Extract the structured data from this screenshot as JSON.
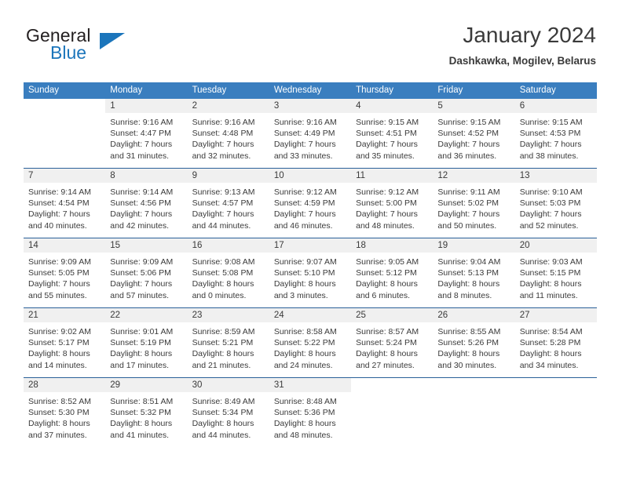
{
  "brand": {
    "name_line1": "General",
    "name_line2": "Blue",
    "logo_icon": "blue-triangle-icon",
    "accent_color": "#1b75bb"
  },
  "header": {
    "title": "January 2024",
    "subtitle": "Dashkawka, Mogilev, Belarus"
  },
  "theme": {
    "header_bar_color": "#3a7ebf",
    "week_divider_color": "#2a6099",
    "date_band_color": "#f0f0f0",
    "text_color": "#3a3a3a"
  },
  "weekdays": [
    "Sunday",
    "Monday",
    "Tuesday",
    "Wednesday",
    "Thursday",
    "Friday",
    "Saturday"
  ],
  "weeks": [
    {
      "dates": [
        "",
        "1",
        "2",
        "3",
        "4",
        "5",
        "6"
      ],
      "cells": [
        {
          "lines": [
            "",
            "",
            "",
            ""
          ]
        },
        {
          "lines": [
            "Sunrise: 9:16 AM",
            "Sunset: 4:47 PM",
            "Daylight: 7 hours",
            "and 31 minutes."
          ]
        },
        {
          "lines": [
            "Sunrise: 9:16 AM",
            "Sunset: 4:48 PM",
            "Daylight: 7 hours",
            "and 32 minutes."
          ]
        },
        {
          "lines": [
            "Sunrise: 9:16 AM",
            "Sunset: 4:49 PM",
            "Daylight: 7 hours",
            "and 33 minutes."
          ]
        },
        {
          "lines": [
            "Sunrise: 9:15 AM",
            "Sunset: 4:51 PM",
            "Daylight: 7 hours",
            "and 35 minutes."
          ]
        },
        {
          "lines": [
            "Sunrise: 9:15 AM",
            "Sunset: 4:52 PM",
            "Daylight: 7 hours",
            "and 36 minutes."
          ]
        },
        {
          "lines": [
            "Sunrise: 9:15 AM",
            "Sunset: 4:53 PM",
            "Daylight: 7 hours",
            "and 38 minutes."
          ]
        }
      ]
    },
    {
      "dates": [
        "7",
        "8",
        "9",
        "10",
        "11",
        "12",
        "13"
      ],
      "cells": [
        {
          "lines": [
            "Sunrise: 9:14 AM",
            "Sunset: 4:54 PM",
            "Daylight: 7 hours",
            "and 40 minutes."
          ]
        },
        {
          "lines": [
            "Sunrise: 9:14 AM",
            "Sunset: 4:56 PM",
            "Daylight: 7 hours",
            "and 42 minutes."
          ]
        },
        {
          "lines": [
            "Sunrise: 9:13 AM",
            "Sunset: 4:57 PM",
            "Daylight: 7 hours",
            "and 44 minutes."
          ]
        },
        {
          "lines": [
            "Sunrise: 9:12 AM",
            "Sunset: 4:59 PM",
            "Daylight: 7 hours",
            "and 46 minutes."
          ]
        },
        {
          "lines": [
            "Sunrise: 9:12 AM",
            "Sunset: 5:00 PM",
            "Daylight: 7 hours",
            "and 48 minutes."
          ]
        },
        {
          "lines": [
            "Sunrise: 9:11 AM",
            "Sunset: 5:02 PM",
            "Daylight: 7 hours",
            "and 50 minutes."
          ]
        },
        {
          "lines": [
            "Sunrise: 9:10 AM",
            "Sunset: 5:03 PM",
            "Daylight: 7 hours",
            "and 52 minutes."
          ]
        }
      ]
    },
    {
      "dates": [
        "14",
        "15",
        "16",
        "17",
        "18",
        "19",
        "20"
      ],
      "cells": [
        {
          "lines": [
            "Sunrise: 9:09 AM",
            "Sunset: 5:05 PM",
            "Daylight: 7 hours",
            "and 55 minutes."
          ]
        },
        {
          "lines": [
            "Sunrise: 9:09 AM",
            "Sunset: 5:06 PM",
            "Daylight: 7 hours",
            "and 57 minutes."
          ]
        },
        {
          "lines": [
            "Sunrise: 9:08 AM",
            "Sunset: 5:08 PM",
            "Daylight: 8 hours",
            "and 0 minutes."
          ]
        },
        {
          "lines": [
            "Sunrise: 9:07 AM",
            "Sunset: 5:10 PM",
            "Daylight: 8 hours",
            "and 3 minutes."
          ]
        },
        {
          "lines": [
            "Sunrise: 9:05 AM",
            "Sunset: 5:12 PM",
            "Daylight: 8 hours",
            "and 6 minutes."
          ]
        },
        {
          "lines": [
            "Sunrise: 9:04 AM",
            "Sunset: 5:13 PM",
            "Daylight: 8 hours",
            "and 8 minutes."
          ]
        },
        {
          "lines": [
            "Sunrise: 9:03 AM",
            "Sunset: 5:15 PM",
            "Daylight: 8 hours",
            "and 11 minutes."
          ]
        }
      ]
    },
    {
      "dates": [
        "21",
        "22",
        "23",
        "24",
        "25",
        "26",
        "27"
      ],
      "cells": [
        {
          "lines": [
            "Sunrise: 9:02 AM",
            "Sunset: 5:17 PM",
            "Daylight: 8 hours",
            "and 14 minutes."
          ]
        },
        {
          "lines": [
            "Sunrise: 9:01 AM",
            "Sunset: 5:19 PM",
            "Daylight: 8 hours",
            "and 17 minutes."
          ]
        },
        {
          "lines": [
            "Sunrise: 8:59 AM",
            "Sunset: 5:21 PM",
            "Daylight: 8 hours",
            "and 21 minutes."
          ]
        },
        {
          "lines": [
            "Sunrise: 8:58 AM",
            "Sunset: 5:22 PM",
            "Daylight: 8 hours",
            "and 24 minutes."
          ]
        },
        {
          "lines": [
            "Sunrise: 8:57 AM",
            "Sunset: 5:24 PM",
            "Daylight: 8 hours",
            "and 27 minutes."
          ]
        },
        {
          "lines": [
            "Sunrise: 8:55 AM",
            "Sunset: 5:26 PM",
            "Daylight: 8 hours",
            "and 30 minutes."
          ]
        },
        {
          "lines": [
            "Sunrise: 8:54 AM",
            "Sunset: 5:28 PM",
            "Daylight: 8 hours",
            "and 34 minutes."
          ]
        }
      ]
    },
    {
      "dates": [
        "28",
        "29",
        "30",
        "31",
        "",
        "",
        ""
      ],
      "cells": [
        {
          "lines": [
            "Sunrise: 8:52 AM",
            "Sunset: 5:30 PM",
            "Daylight: 8 hours",
            "and 37 minutes."
          ]
        },
        {
          "lines": [
            "Sunrise: 8:51 AM",
            "Sunset: 5:32 PM",
            "Daylight: 8 hours",
            "and 41 minutes."
          ]
        },
        {
          "lines": [
            "Sunrise: 8:49 AM",
            "Sunset: 5:34 PM",
            "Daylight: 8 hours",
            "and 44 minutes."
          ]
        },
        {
          "lines": [
            "Sunrise: 8:48 AM",
            "Sunset: 5:36 PM",
            "Daylight: 8 hours",
            "and 48 minutes."
          ]
        },
        {
          "lines": [
            "",
            "",
            "",
            ""
          ]
        },
        {
          "lines": [
            "",
            "",
            "",
            ""
          ]
        },
        {
          "lines": [
            "",
            "",
            "",
            ""
          ]
        }
      ]
    }
  ]
}
